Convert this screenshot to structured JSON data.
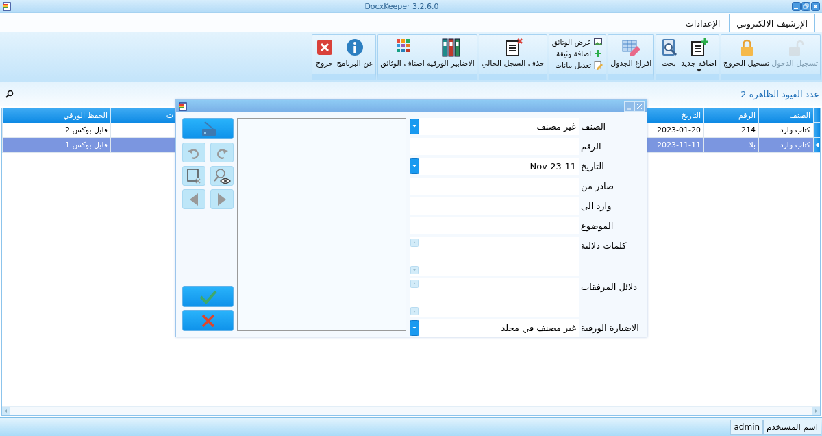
{
  "window": {
    "title": "DocxKeeper 3.2.6.0"
  },
  "tabs": [
    {
      "label": "الإرشيف الالكتروني",
      "selected": true
    },
    {
      "label": "الإعدادات",
      "selected": false
    }
  ],
  "ribbon": {
    "groups": [
      {
        "buttons": [
          {
            "kind": "large",
            "label": "تسجيل الدخول",
            "disabled": true
          },
          {
            "kind": "large",
            "label": "تسجيل الخروج",
            "disabled": false
          }
        ]
      },
      {
        "buttons": [
          {
            "kind": "menu",
            "label": "اضافة جديد",
            "disabled": false
          },
          {
            "kind": "large",
            "label": "بحث",
            "disabled": false
          }
        ]
      },
      {
        "buttons": [
          {
            "kind": "large",
            "label": "افراغ الجدول",
            "disabled": false
          }
        ]
      },
      {
        "buttons": [
          {
            "kind": "small",
            "label": "عرض الوثائق",
            "disabled": false
          },
          {
            "kind": "small",
            "label": "اضافة وثيقة",
            "disabled": false
          },
          {
            "kind": "small",
            "label": "تعديل بيانات",
            "disabled": false
          }
        ]
      },
      {
        "buttons": [
          {
            "kind": "large",
            "label": "حذف السجل الحالي",
            "disabled": false
          }
        ]
      },
      {
        "buttons": [
          {
            "kind": "large",
            "label": "الاضابير الورقية",
            "disabled": false
          },
          {
            "kind": "large",
            "label": "اصناف الوثائق",
            "disabled": false
          }
        ]
      },
      {
        "buttons": [
          {
            "kind": "large",
            "label": "عن البرنامج",
            "disabled": false
          },
          {
            "kind": "large",
            "label": "خروج",
            "disabled": false
          }
        ]
      }
    ]
  },
  "records_count": "عدد القيود الظاهرة 2",
  "table": {
    "columns": [
      "الصنف",
      "الرقم",
      "التاريخ",
      "ت",
      "الحفظ الورقي"
    ],
    "rows": [
      {
        "category": "كتاب وارد",
        "number": "214",
        "date": "2023-01-20",
        "paper_file": "فايل بوكس 2",
        "selected": false
      },
      {
        "category": "كتاب وارد",
        "number": "بلا",
        "date": "2023-11-11",
        "paper_file": "فايل بوكس 1",
        "selected": true
      }
    ]
  },
  "dialog": {
    "tools": [
      {
        "kind": "wide",
        "disabled": false
      },
      {
        "kind": "small",
        "disabled": true
      },
      {
        "kind": "small",
        "disabled": true
      },
      {
        "kind": "small",
        "disabled": true
      },
      {
        "kind": "small",
        "disabled": true
      },
      {
        "kind": "small",
        "disabled": true
      },
      {
        "kind": "small",
        "disabled": true
      }
    ],
    "actions": [
      {
        "kind": "confirm"
      },
      {
        "kind": "cancel"
      }
    ],
    "fields": [
      {
        "kind": "combo",
        "label": "الصنف",
        "value": "غير مصنف"
      },
      {
        "kind": "text",
        "label": "الرقم"
      },
      {
        "kind": "combo",
        "label": "التاريخ",
        "value": "Nov-23-11"
      },
      {
        "kind": "text",
        "label": "صادر من"
      },
      {
        "kind": "text",
        "label": "وارد الى"
      },
      {
        "kind": "text",
        "label": "الموضوع"
      },
      {
        "kind": "memo",
        "label": "كلمات دلالية"
      },
      {
        "kind": "memo",
        "label": "دلائل المرفقات"
      },
      {
        "kind": "combo",
        "label": "الاضبارة الورقية",
        "value": "غير مصنف في مجلد"
      }
    ]
  },
  "status_bar": {
    "user_label": "اسم المستخدم",
    "user": "admin"
  }
}
